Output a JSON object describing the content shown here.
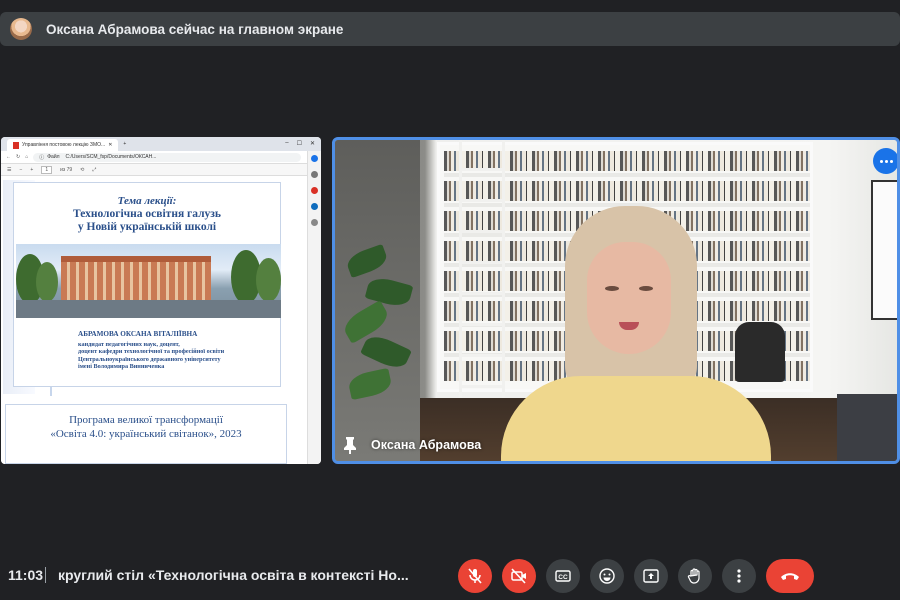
{
  "banner": {
    "text": "Оксана Абрамова сейчас на главном экране"
  },
  "presentation": {
    "browser_tab": "Управління постовою лекцію ЗМО...",
    "address_label": "Файл",
    "address_url": "C:/Users/SCM_fsp/Documents/ОКСАН...",
    "pdf_page": "1",
    "pdf_pages": "из 79",
    "slide": {
      "lecture_heading": "Тема лекції:",
      "lecture_title_1": "Технологічна освітня галузь",
      "lecture_title_2": "у Новій українській школі",
      "author_name": "АБРАМОВА ОКСАНА ВІТАЛІЇВНА",
      "author_line_1": "кандидат педагогічних наук, доцент,",
      "author_line_2": "доцент кафедри технологічної та професійної освіти",
      "author_line_3": "Центральноукраїнського державного університету",
      "author_line_4": "імені Володимира Винниченка",
      "program_title_1": "Програма великої трансформації",
      "program_title_2": "«Освіта 4.0: український світанок», 2023"
    }
  },
  "camera": {
    "participant_name": "Оксана Абрамова"
  },
  "bottom_bar": {
    "time": "11:03",
    "meeting_title": "круглий стіл «Технологічна освіта в контексті Но..."
  },
  "colors": {
    "accent": "#4f8fe6",
    "danger": "#ea4335",
    "control_bg": "#3c4043"
  }
}
